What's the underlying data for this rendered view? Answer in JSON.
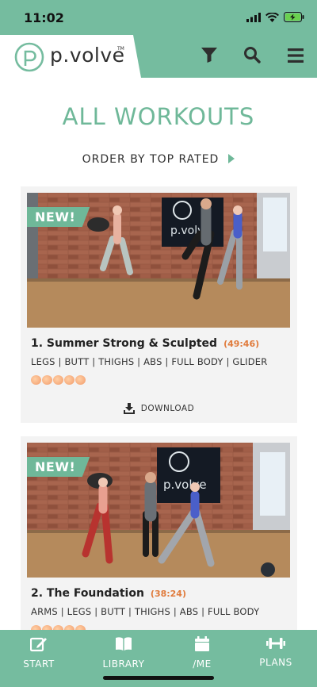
{
  "status": {
    "time": "11:02"
  },
  "header": {
    "logo_text": "p.volve",
    "logo_tm": "TM"
  },
  "page": {
    "title": "ALL WORKOUTS",
    "order_label": "ORDER BY TOP RATED"
  },
  "workouts": [
    {
      "badge": "NEW!",
      "title": "1. Summer Strong & Sculpted",
      "duration": "(49:46)",
      "tags": "LEGS | BUTT | THIGHS | ABS | FULL BODY | GLIDER",
      "rating": 5,
      "download_label": "DOWNLOAD",
      "poster_text": "p.volve"
    },
    {
      "badge": "NEW!",
      "title": "2. The Foundation",
      "duration": "(38:24)",
      "tags": "ARMS | LEGS | BUTT | THIGHS | ABS | FULL BODY",
      "rating": 5,
      "poster_text": "p.volve"
    }
  ],
  "nav": [
    {
      "label": "START",
      "icon": "edit-icon"
    },
    {
      "label": "LIBRARY",
      "icon": "book-icon"
    },
    {
      "label": "/ME",
      "icon": "calendar-icon"
    },
    {
      "label": "PLANS",
      "icon": "dumbbell-icon"
    }
  ],
  "colors": {
    "brand_green": "#75bc9f",
    "title_green": "#6fb899",
    "duration_orange": "#e07b3c"
  }
}
